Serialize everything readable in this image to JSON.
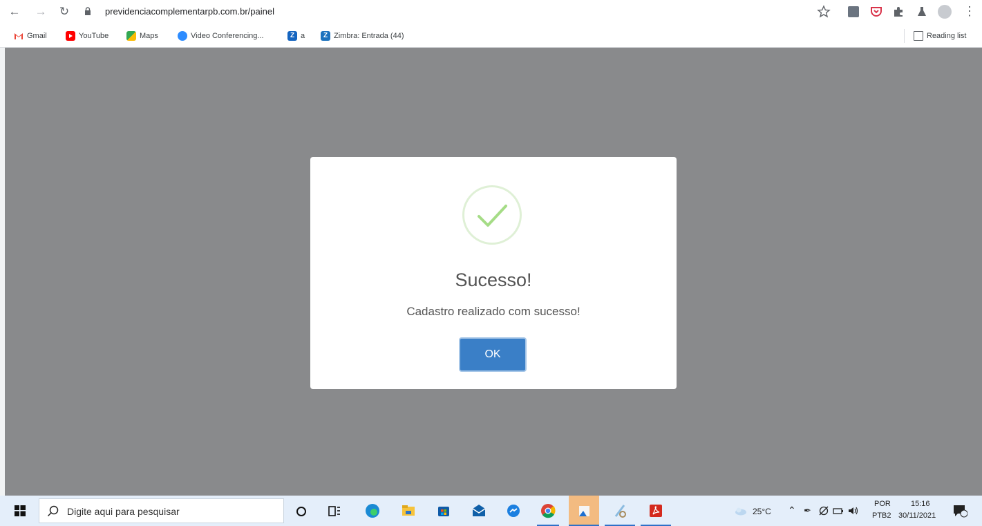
{
  "browser": {
    "url": "previdenciacomplementarpb.com.br/painel",
    "reading_list_label": "Reading list"
  },
  "bookmarks": [
    {
      "label": "Gmail",
      "icon": "gmail-icon",
      "color": "#ea4335"
    },
    {
      "label": "YouTube",
      "icon": "youtube-icon",
      "color": "#ff0000"
    },
    {
      "label": "Maps",
      "icon": "maps-icon",
      "color": "#34a853"
    },
    {
      "label": "Video Conferencing...",
      "icon": "video-conferencing-icon",
      "color": "#2d8cff"
    },
    {
      "label": "a",
      "icon": "zimbra-z-icon",
      "color": "#1565c0"
    },
    {
      "label": "Zimbra: Entrada (44)",
      "icon": "zimbra-icon",
      "color": "#1e73be"
    }
  ],
  "modal": {
    "title": "Sucesso!",
    "message": "Cadastro realizado com sucesso!",
    "ok_label": "OK",
    "icon": "success-check-icon",
    "accent": "#a5dc86",
    "button_color": "#3a7fc7"
  },
  "taskbar": {
    "search_placeholder": "Digite aqui para pesquisar",
    "weather": "25°C",
    "lang_top": "POR",
    "lang_bottom": "PTB2",
    "time": "15:16",
    "date": "30/11/2021"
  }
}
